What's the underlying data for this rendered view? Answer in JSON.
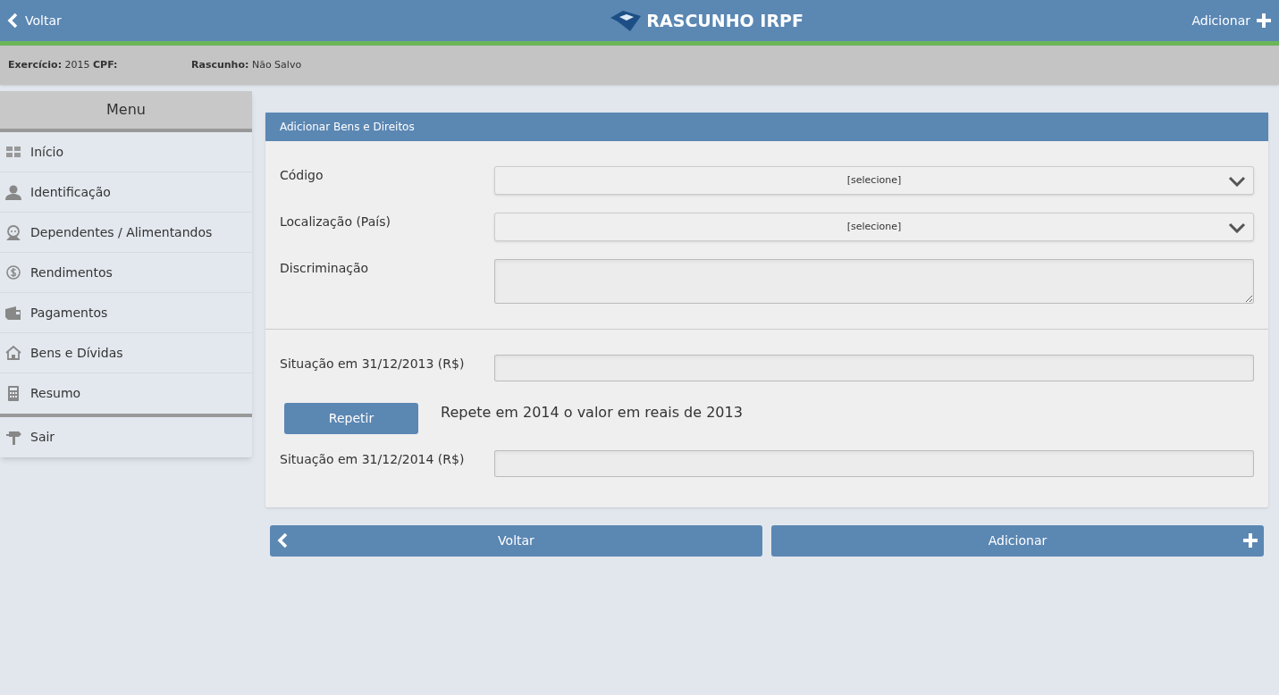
{
  "header": {
    "back": "Voltar",
    "title": "RASCUNHO IRPF",
    "add": "Adicionar"
  },
  "info_bar": {
    "exercicio_label": "Exercício:",
    "exercicio": "2015",
    "cpf_label": "CPF:",
    "rascunho_label": "Rascunho:",
    "rascunho": "Não Salvo"
  },
  "sidebar": {
    "title": "Menu",
    "items": [
      {
        "label": "Início"
      },
      {
        "label": "Identificação"
      },
      {
        "label": "Dependentes / Alimentandos"
      },
      {
        "label": "Rendimentos"
      },
      {
        "label": "Pagamentos"
      },
      {
        "label": "Bens e Dívidas"
      },
      {
        "label": "Resumo"
      }
    ],
    "exit": {
      "label": "Sair"
    }
  },
  "form": {
    "title": "Adicionar Bens e Direitos",
    "fields": [
      {
        "kind": "select",
        "label": "Código",
        "value": "[selecione]"
      },
      {
        "kind": "select",
        "label": "Localização (País)",
        "value": "[selecione]"
      },
      {
        "kind": "textarea",
        "label": "Discriminação"
      }
    ],
    "values": [
      {
        "kind": "text",
        "label": "Situação em 31/12/2013 (R$)"
      },
      {
        "kind": "repeat",
        "button": "Repetir",
        "text": "Repete em 2014 o valor em reais de 2013"
      },
      {
        "kind": "text",
        "label": "Situação em 31/12/2014 (R$)"
      }
    ]
  },
  "actions": {
    "back": "Voltar",
    "add": "Adicionar"
  }
}
